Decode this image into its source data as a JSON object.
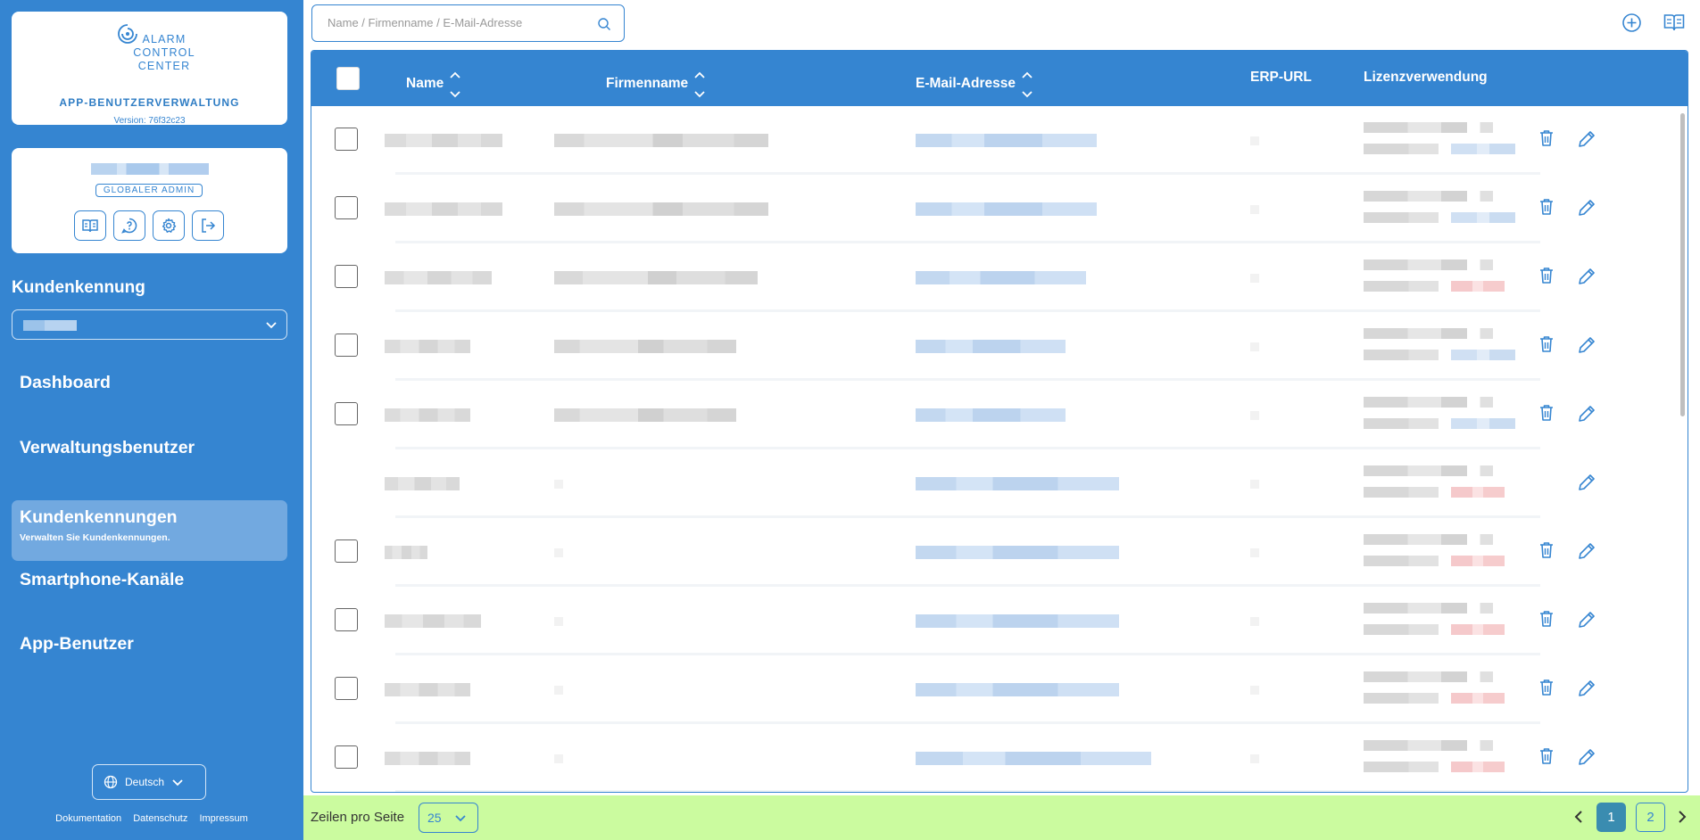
{
  "app": {
    "logo_lines": [
      "ALARM",
      "CONTROL",
      "CENTER"
    ],
    "title": "APP-BENUTZERVERWALTUNG",
    "version": "Version: 76f32c23"
  },
  "user": {
    "role": "GLOBALER ADMIN"
  },
  "customer": {
    "label": "Kundenkennung"
  },
  "nav": {
    "dashboard": "Dashboard",
    "admin_users": "Verwaltungsbenutzer",
    "customer_ids": "Kundenkennungen",
    "customer_ids_sub": "Verwalten Sie Kundenkennungen.",
    "channels": "Smartphone-Kanäle",
    "app_users": "App-Benutzer"
  },
  "language": {
    "selected": "Deutsch"
  },
  "footer": {
    "docs": "Dokumentation",
    "privacy": "Datenschutz",
    "imprint": "Impressum"
  },
  "search": {
    "placeholder": "Name / Firmenname / E-Mail-Adresse"
  },
  "table": {
    "headers": {
      "name": "Name",
      "company": "Firmenname",
      "email": "E-Mail-Adresse",
      "erp": "ERP-URL",
      "license": "Lizenzverwendung"
    }
  },
  "pagination": {
    "rows_label": "Zeilen pro Seite",
    "rows_value": "25",
    "pages": [
      "1",
      "2"
    ],
    "current_page": 1
  },
  "icons": {
    "search": "search-icon",
    "add": "plus-circle-icon",
    "docs": "book-open-icon",
    "help": "help-icon",
    "settings": "gear-icon",
    "logout": "logout-icon",
    "delete": "trash-icon",
    "edit": "pencil-icon",
    "language": "globe-icon"
  },
  "colors": {
    "primary": "#3585d1",
    "pager_bg": "#cbfb9f",
    "active_page": "#3a8cb0"
  }
}
